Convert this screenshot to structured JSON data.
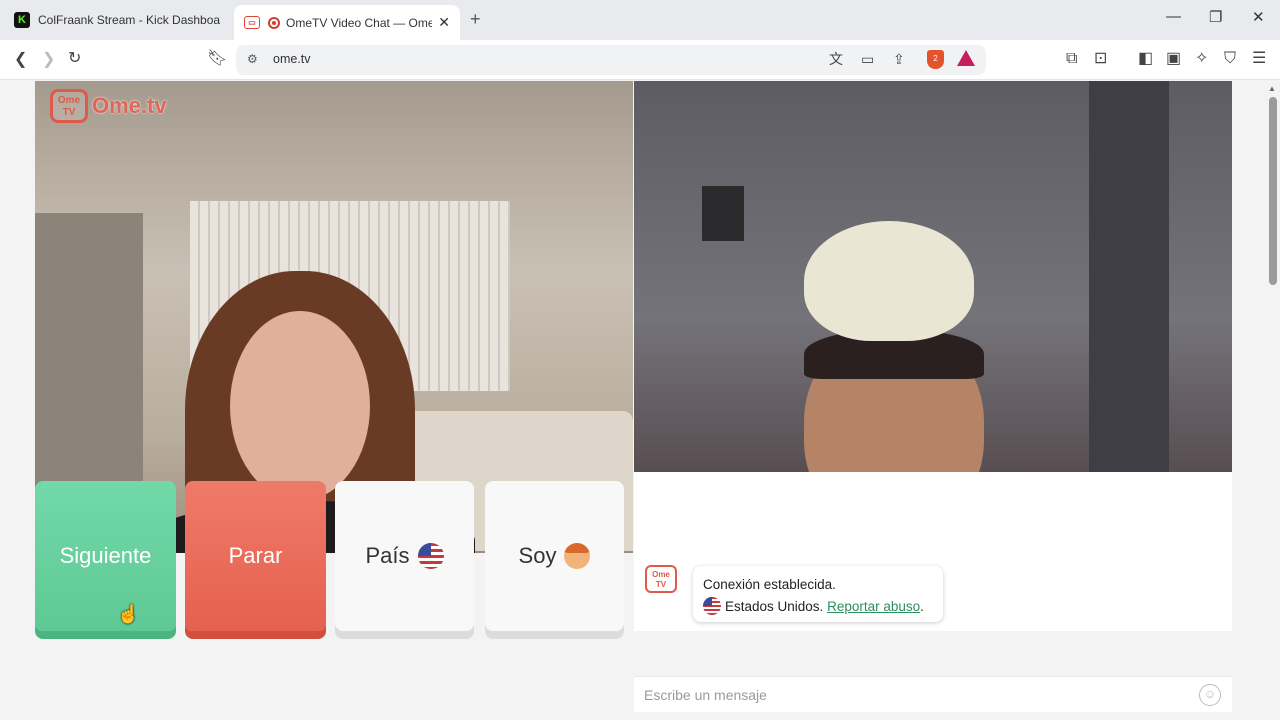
{
  "browser": {
    "tabs": [
      {
        "title": "ColFraank Stream - Kick Dashboard",
        "favicon": "kick-icon",
        "active": false
      },
      {
        "title": "OmeTV Video Chat — Omegl",
        "favicon": "ometv-icon",
        "active": true,
        "recording": true
      }
    ],
    "new_tab": "+",
    "window_controls": {
      "minimize": "—",
      "restore": "❐",
      "close": "✕"
    },
    "address": "ome.tv",
    "brave_badge_count": "2"
  },
  "app": {
    "logo_text": "Ome.tv",
    "logo_badge": "Ome TV",
    "buttons": {
      "next": "Siguiente",
      "stop": "Parar",
      "country": "País",
      "soy": "Soy"
    },
    "chat": {
      "status": "Conexión establecida.",
      "country": "Estados Unidos.",
      "report_link": "Reportar abuso",
      "report_suffix": ".",
      "input_placeholder": "Escribe un mensaje"
    }
  },
  "colors": {
    "next_button": "#5ec995",
    "stop_button": "#e6604e",
    "brand": "#e05a4b",
    "link": "#2b8f5e"
  }
}
